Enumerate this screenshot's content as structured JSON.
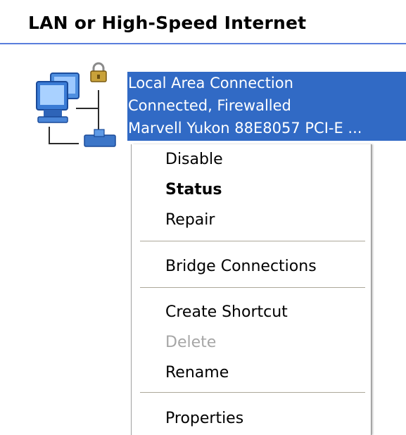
{
  "group": {
    "title": "LAN or High-Speed Internet"
  },
  "connection": {
    "name": "Local Area Connection",
    "status": "Connected, Firewalled",
    "device": "Marvell Yukon 88E8057 PCI-E ...",
    "icon": "network-connection-icon",
    "lock_icon": "padlock-icon",
    "selected_color": "#316ac5"
  },
  "context_menu": {
    "items": [
      {
        "label": "Disable",
        "state": "normal"
      },
      {
        "label": "Status",
        "state": "default"
      },
      {
        "label": "Repair",
        "state": "normal"
      },
      {
        "label": "Bridge Connections",
        "state": "normal"
      },
      {
        "label": "Create Shortcut",
        "state": "normal"
      },
      {
        "label": "Delete",
        "state": "disabled"
      },
      {
        "label": "Rename",
        "state": "normal"
      },
      {
        "label": "Properties",
        "state": "normal"
      }
    ]
  }
}
